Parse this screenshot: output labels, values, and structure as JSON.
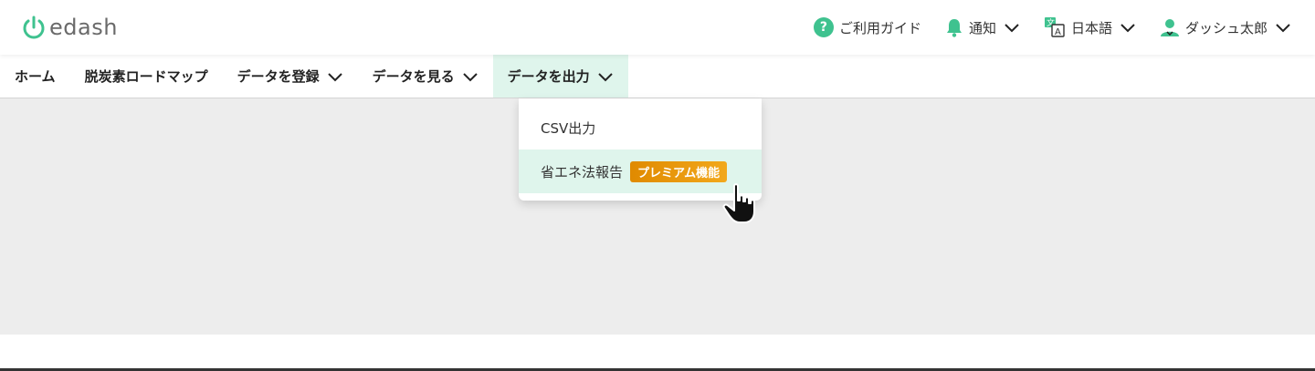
{
  "header": {
    "logo_text": "edash",
    "help_label": "ご利用ガイド",
    "notify_label": "通知",
    "language_label": "日本語",
    "user_label": "ダッシュ太郎"
  },
  "nav": {
    "items": [
      {
        "label": "ホーム"
      },
      {
        "label": "脱炭素ロードマップ"
      },
      {
        "label": "データを登録"
      },
      {
        "label": "データを見る"
      },
      {
        "label": "データを出力"
      }
    ]
  },
  "dropdown": {
    "items": [
      {
        "label": "CSV出力"
      },
      {
        "label": "省エネ法報告",
        "badge": "プレミアム機能"
      }
    ]
  },
  "colors": {
    "accent": "#3fc28f",
    "active_bg": "#dff5ec",
    "badge": "#e8950a",
    "content_bg": "#ededed"
  }
}
